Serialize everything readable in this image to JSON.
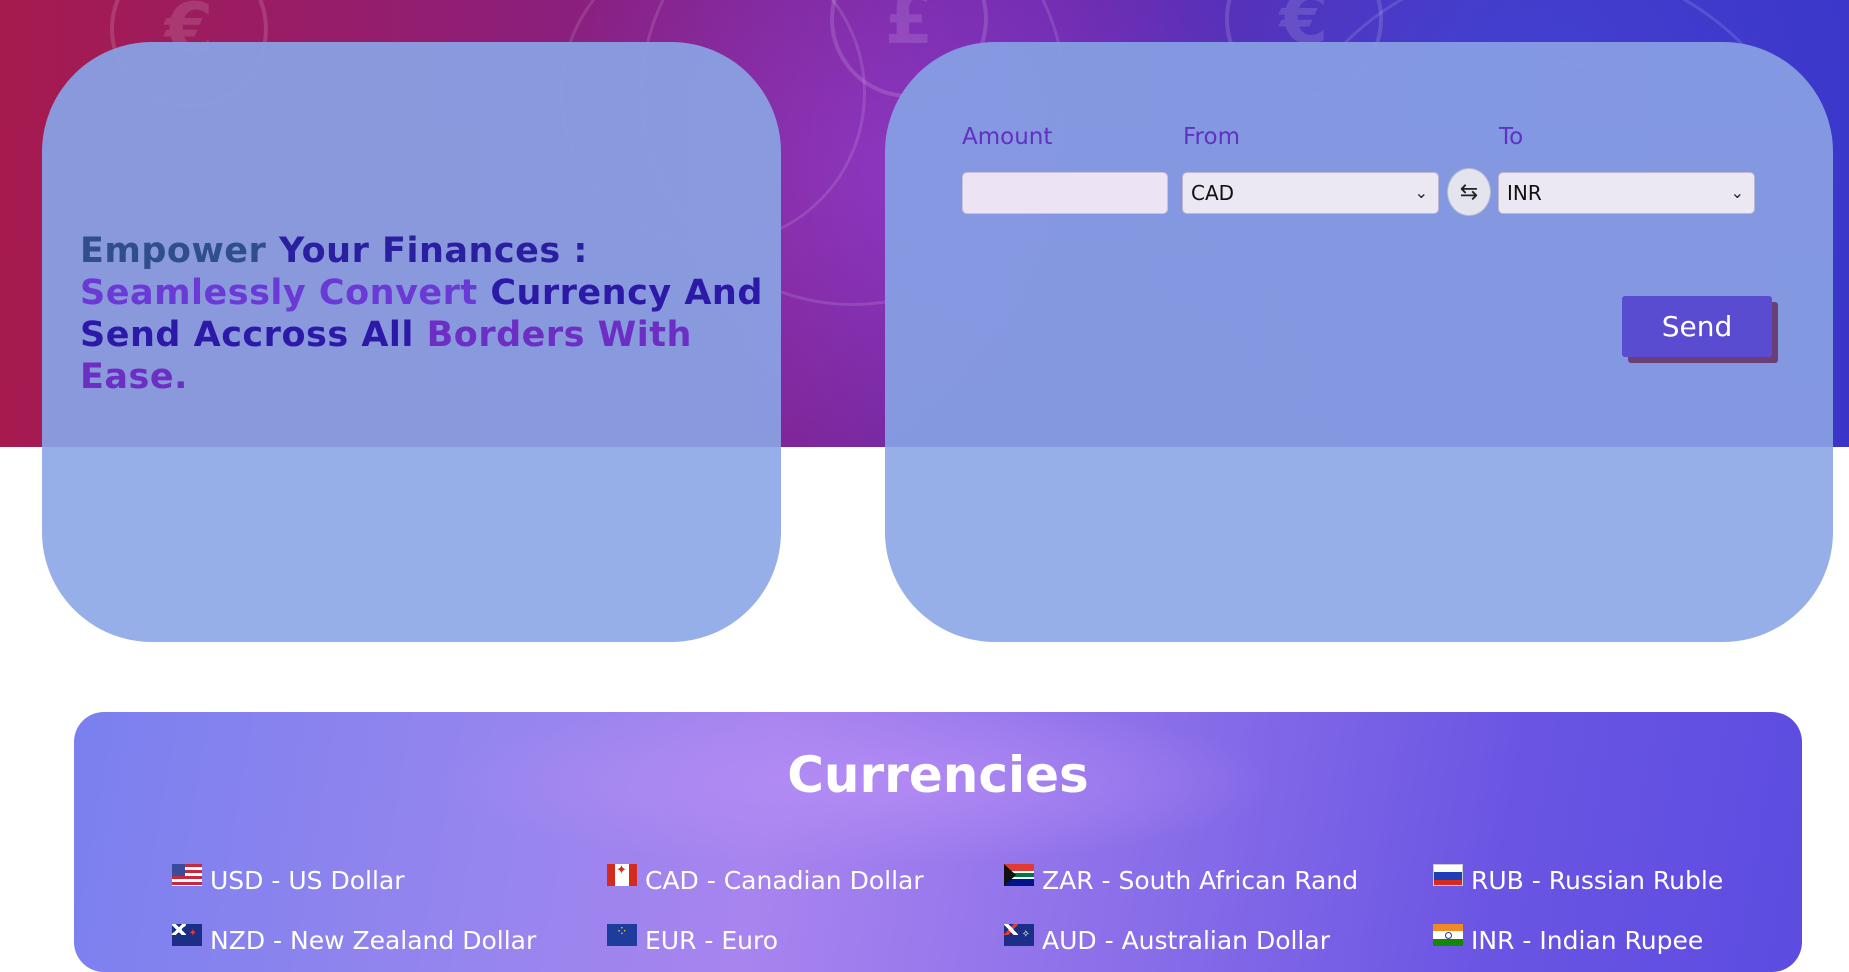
{
  "hero": {
    "headline": {
      "part1": "Empower",
      "part2": "Your Finances :",
      "part3": "Seamlessly Convert",
      "part4": "Currency And Send Accross All",
      "part5": "Borders With Ease."
    }
  },
  "converter": {
    "amount_label": "Amount",
    "from_label": "From",
    "to_label": "To",
    "amount_value": "",
    "from_value": "CAD",
    "to_value": "INR",
    "swap_icon": "swap-arrows-icon",
    "send_label": "Send"
  },
  "currencies": {
    "title": "Currencies",
    "items": [
      {
        "flag": "us-flag-icon",
        "label": "USD - US Dollar"
      },
      {
        "flag": "canada-flag-icon",
        "label": "CAD - Canadian Dollar"
      },
      {
        "flag": "south-africa-flag-icon",
        "label": "ZAR - South African Rand"
      },
      {
        "flag": "russia-flag-icon",
        "label": "RUB - Russian Ruble"
      },
      {
        "flag": "new-zealand-flag-icon",
        "label": "NZD - New Zealand Dollar"
      },
      {
        "flag": "eu-flag-icon",
        "label": "EUR - Euro"
      },
      {
        "flag": "australia-flag-icon",
        "label": "AUD - Australian Dollar"
      },
      {
        "flag": "india-flag-icon",
        "label": "INR - Indian Rupee"
      }
    ]
  },
  "colors": {
    "accent": "#5a4cd0",
    "label_purple": "#5f32c0",
    "card_blue": "#8a9de0"
  }
}
